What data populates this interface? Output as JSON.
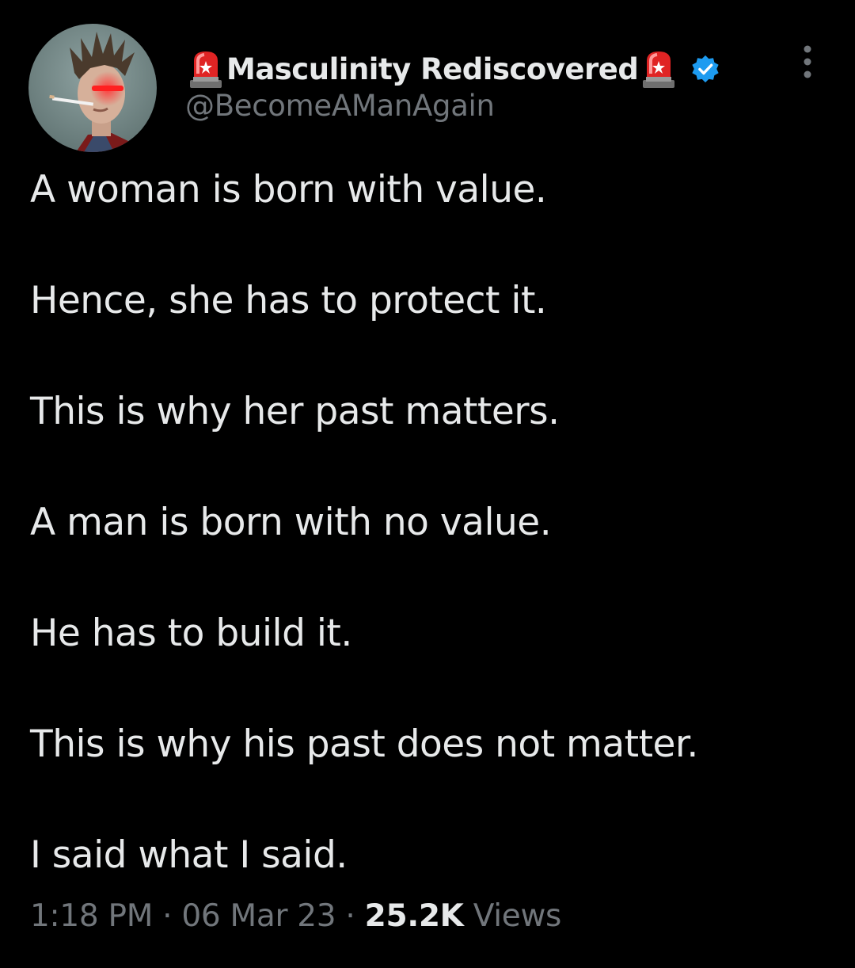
{
  "author": {
    "display_name": "Masculinity Rediscovered",
    "handle": "@BecomeAManAgain",
    "verified": true,
    "name_emoji": "police-car-light-icon",
    "verified_color": "#1d9bf0"
  },
  "tweet": {
    "lines": [
      "A woman is born with value.",
      "Hence, she has to protect it.",
      "This is why her past matters.",
      "A man is born with no value.",
      "He has to build it.",
      "This is why his past does not matter.",
      "I said what I said."
    ]
  },
  "meta": {
    "time": "1:18 PM",
    "separator": "·",
    "date": "06 Mar 23",
    "views_count": "25.2K",
    "views_label": "Views"
  },
  "colors": {
    "background": "#000000",
    "text": "#e7e9ea",
    "secondary_text": "#71767b"
  }
}
